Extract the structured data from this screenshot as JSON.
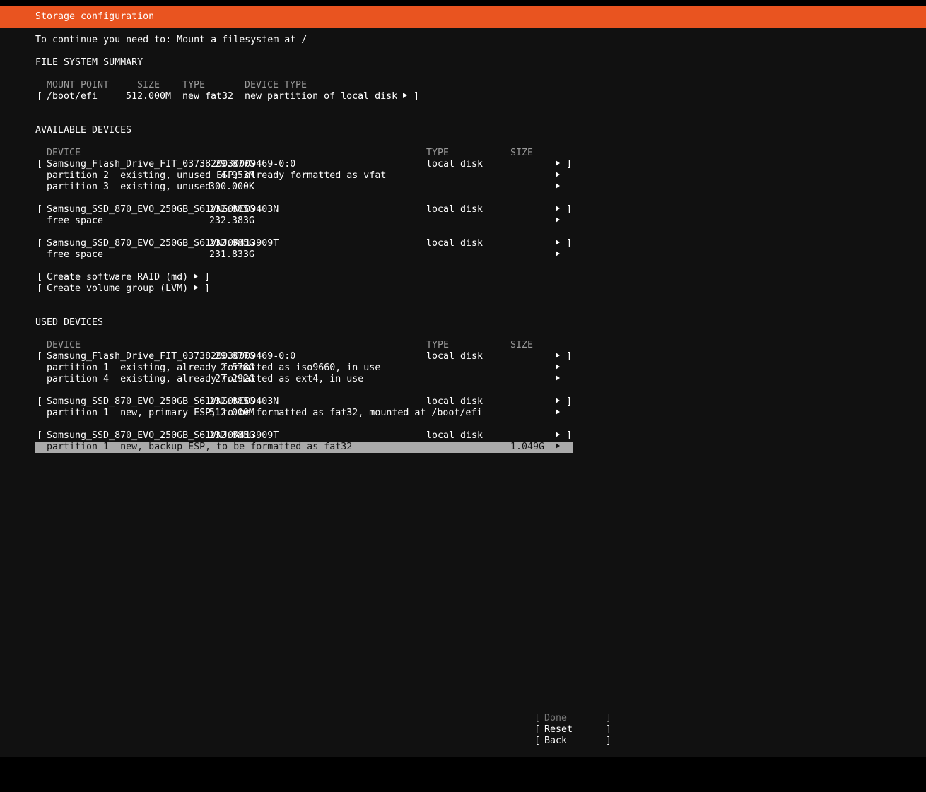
{
  "title": "Storage configuration",
  "notice": "To continue you need to: Mount a filesystem at /",
  "fs_summary": {
    "heading": "FILE SYSTEM SUMMARY",
    "headers": {
      "mount": "MOUNT POINT",
      "size": "SIZE",
      "type": "TYPE",
      "device_type": "DEVICE TYPE"
    },
    "rows": [
      {
        "mount": "/boot/efi",
        "size": "512.000M",
        "type": "new fat32",
        "device_type": "new partition of local disk"
      }
    ]
  },
  "available": {
    "heading": "AVAILABLE DEVICES",
    "headers": {
      "device": "DEVICE",
      "type": "TYPE",
      "size": "SIZE"
    },
    "disks": [
      {
        "name": "Samsung_Flash_Drive_FIT_0373820030009469-0:0",
        "type": "local disk",
        "size": "29.877G",
        "children": [
          {
            "label": "partition 2  existing, unused ESP, already formatted as vfat",
            "size": "4.953M"
          },
          {
            "label": "partition 3  existing, unused",
            "size": "300.000K"
          }
        ]
      },
      {
        "name": "Samsung_SSD_870_EVO_250GB_S61VNG0NC09403N",
        "type": "local disk",
        "size": "232.885G",
        "children": [
          {
            "label": "free space",
            "size": "232.383G"
          }
        ]
      },
      {
        "name": "Samsung_SSD_870_EVO_250GB_S61VNJ0R413909T",
        "type": "local disk",
        "size": "232.885G",
        "children": [
          {
            "label": "free space",
            "size": "231.833G"
          }
        ]
      }
    ],
    "actions": [
      "Create software RAID (md)",
      "Create volume group (LVM)"
    ]
  },
  "used": {
    "heading": "USED DEVICES",
    "headers": {
      "device": "DEVICE",
      "type": "TYPE",
      "size": "SIZE"
    },
    "disks": [
      {
        "name": "Samsung_Flash_Drive_FIT_0373820030009469-0:0",
        "type": "local disk",
        "size": "29.877G",
        "children": [
          {
            "label": "partition 1  existing, already formatted as iso9660, in use",
            "size": "2.578G"
          },
          {
            "label": "partition 4  existing, already formatted as ext4, in use",
            "size": "27.292G"
          }
        ]
      },
      {
        "name": "Samsung_SSD_870_EVO_250GB_S61VNG0NC09403N",
        "type": "local disk",
        "size": "232.885G",
        "children": [
          {
            "label": "partition 1  new, primary ESP, to be formatted as fat32, mounted at /boot/efi",
            "size": "512.000M"
          }
        ]
      },
      {
        "name": "Samsung_SSD_870_EVO_250GB_S61VNJ0R413909T",
        "type": "local disk",
        "size": "232.885G",
        "children": [
          {
            "label": "partition 1  new, backup ESP, to be formatted as fat32",
            "size": "1.049G",
            "selected": true
          }
        ]
      }
    ]
  },
  "buttons": {
    "done": "Done",
    "reset": "Reset",
    "back": "Back"
  },
  "colors": {
    "accent": "#e95420",
    "background": "#111111",
    "selection": "#aaaaaa"
  }
}
